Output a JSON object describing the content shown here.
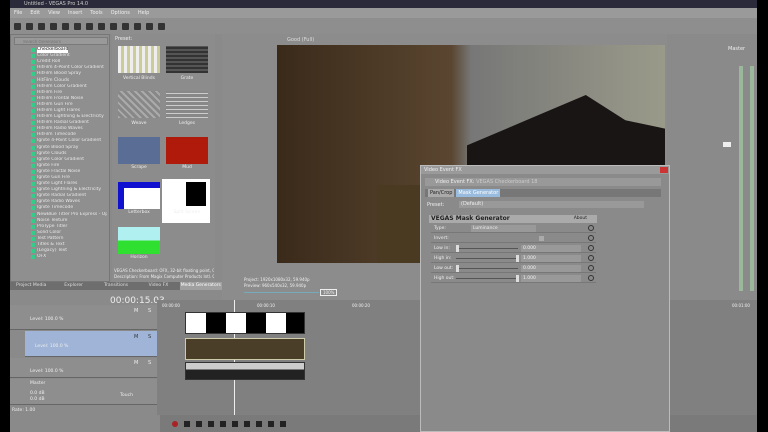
{
  "window": {
    "title": "Untitled - VEGAS Pro 14.0"
  },
  "menu": [
    "File",
    "Edit",
    "View",
    "Insert",
    "Tools",
    "Options",
    "Help"
  ],
  "explorer": {
    "search_placeholder": "Search Generators",
    "items": [
      "Checkerboard",
      "Color Gradient",
      "Credit Roll",
      "HitFilm 4-Point Color Gradient",
      "HitFilm Blood Spray",
      "HitFilm Clouds",
      "HitFilm Color Gradient",
      "HitFilm Fire",
      "HitFilm Frontal Noise",
      "HitFilm Gun Fire",
      "HitFilm Light Flares",
      "HitFilm Lightning & Electricity",
      "HitFilm Radial Gradient",
      "HitFilm Radio Waves",
      "HitFilm Timecode",
      "Ignite 4-Point Color Gradient",
      "Ignite Blood Spray",
      "Ignite Clouds",
      "Ignite Color Gradient",
      "Ignite Fire",
      "Ignite Fractal Noise",
      "Ignite Gun Fire",
      "Ignite Light Flares",
      "Ignite Lightning & Electricity",
      "Ignite Radial Gradient",
      "Ignite Radio Waves",
      "Ignite Timecode",
      "NewBlue Titler Pro Express - Op",
      "Noise Texture",
      "ProType Titler",
      "Solid Color",
      "Test Pattern",
      "Titles & Text",
      "(Legacy) Text",
      "OFX"
    ],
    "selected": "Checkerboard"
  },
  "presets": {
    "label": "Preset:",
    "items": [
      "Vertical Blinds",
      "Grate",
      "Weave",
      "Ledges",
      "Scrape",
      "Mud",
      "Letterbox",
      "Split Screen",
      "Horizon"
    ],
    "status": "VEGAS Checkerboard: OFX, 32-bit floating point, GPU",
    "description": "Description: From Magix Computer Products Intl. Co."
  },
  "tabs": [
    "Project Media",
    "Explorer",
    "Transitions",
    "Video FX",
    "Media Generators"
  ],
  "active_tab": "Media Generators",
  "preview": {
    "quality": "Good (Full)",
    "project": "Project:  1920x1080x32, 59.940p",
    "preview": "Preview:  960x540x32, 59.940p",
    "zoom": "100%"
  },
  "timeline": {
    "timecode": "00:00:15.03",
    "ruler": [
      "00:00:00",
      "00:00:10",
      "00:00:20",
      "00:00:30",
      "00:00:40",
      "00:00:50",
      "00:01:00"
    ],
    "tracks": [
      {
        "level": "Level: 100.0 %"
      },
      {
        "level": "Level: 100.0 %"
      },
      {
        "level": "Level: 100.0 %"
      }
    ],
    "master": {
      "label": "Master",
      "vol": "0.0 dB",
      "pan": "0.0 dB",
      "touch": "Touch"
    },
    "rate": "Rate: 1.00",
    "m": "M",
    "s": "S"
  },
  "mixer": {
    "label": "Master"
  },
  "fx": {
    "title": "Video Event FX",
    "chain_label": "Video Event FX:",
    "chain_target": "VEGAS Checkerboard 18",
    "plugins": [
      "Pan/Crop",
      "Mask Generator"
    ],
    "preset_label": "Preset:",
    "preset_value": "(Default)",
    "plugin_title": "VEGAS Mask Generator",
    "about": "About",
    "params": [
      {
        "name": "Type:",
        "value": "Luminance"
      },
      {
        "name": "Invert:",
        "value": ""
      },
      {
        "name": "Low in:",
        "value": "0.000",
        "level": 0
      },
      {
        "name": "High in:",
        "value": "1.000",
        "level": 1
      },
      {
        "name": "Low out:",
        "value": "0.000",
        "level": 0
      },
      {
        "name": "High out:",
        "value": "1.000",
        "level": 1
      }
    ]
  },
  "colors": {
    "selected_track": "#9fb4d6",
    "panel": "#8a8a8a"
  }
}
